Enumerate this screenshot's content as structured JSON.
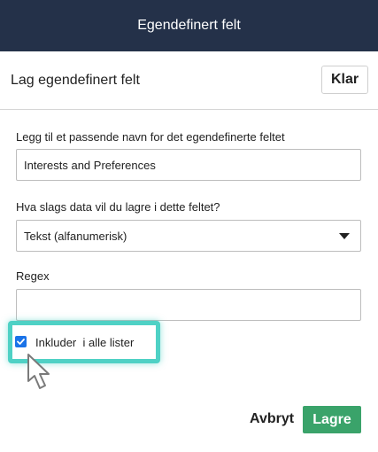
{
  "window": {
    "title": "Egendefinert felt"
  },
  "subheader": {
    "title": "Lag egendefinert felt",
    "done_label": "Klar"
  },
  "form": {
    "name_label": "Legg til et passende navn for det egendefinerte feltet",
    "name_value": "Interests and Preferences",
    "type_label": "Hva slags data vil du lagre i dette feltet?",
    "type_selected": "Tekst (alfanumerisk)",
    "regex_label": "Regex",
    "regex_value": "",
    "include_label": "Inkluder  i alle lister",
    "include_checked": true
  },
  "footer": {
    "cancel_label": "Avbryt",
    "save_label": "Lagre"
  },
  "colors": {
    "titlebar": "#243149",
    "save_button": "#3aa36a",
    "checkbox": "#1a73e8",
    "highlight": "#4fd1c5"
  },
  "icons": {
    "select_caret": "chevron-down-icon",
    "checkbox_check": "check-icon",
    "cursor": "mouse-pointer-icon"
  }
}
